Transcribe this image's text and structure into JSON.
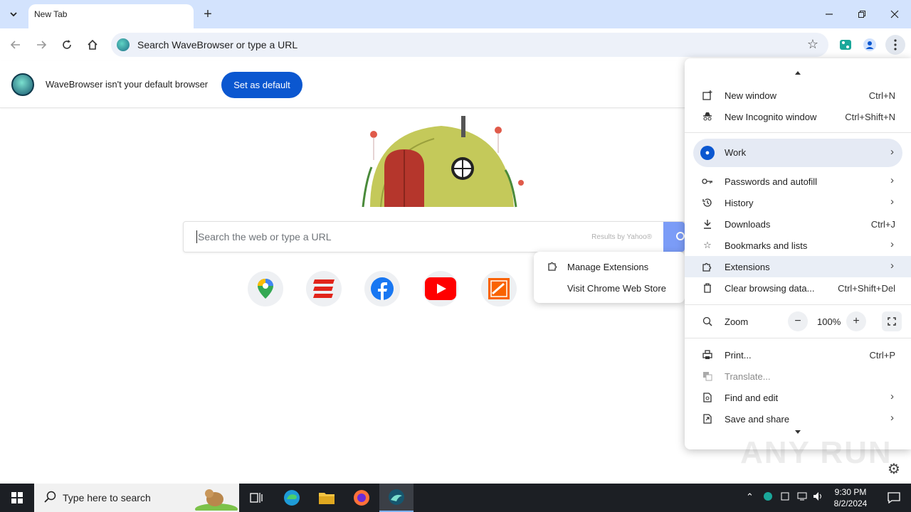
{
  "tabs": [
    {
      "title": "New Tab"
    }
  ],
  "omnibox": {
    "placeholder": "Search WaveBrowser or type a URL"
  },
  "infobar": {
    "message": "WaveBrowser isn't your default browser",
    "button": "Set as default"
  },
  "search": {
    "placeholder": "Search the web or type a URL",
    "provider": "Results by Yahoo®"
  },
  "shortcuts": [
    {
      "name": "Google Maps",
      "color": "#34a853"
    },
    {
      "name": "Eventbrite",
      "color": "#e1251b"
    },
    {
      "name": "Facebook",
      "color": "#1877f2"
    },
    {
      "name": "YouTube",
      "color": "#ff0000"
    },
    {
      "name": "The Home Depot",
      "color": "#f96302"
    }
  ],
  "submenu": {
    "items": [
      {
        "label": "Manage Extensions",
        "icon": "puzzle-icon"
      },
      {
        "label": "Visit Chrome Web Store",
        "icon": ""
      }
    ]
  },
  "menu": {
    "new_window": {
      "label": "New window",
      "shortcut": "Ctrl+N"
    },
    "new_incognito": {
      "label": "New Incognito window",
      "shortcut": "Ctrl+Shift+N"
    },
    "profile": {
      "label": "Work"
    },
    "passwords": {
      "label": "Passwords and autofill"
    },
    "history": {
      "label": "History"
    },
    "downloads": {
      "label": "Downloads",
      "shortcut": "Ctrl+J"
    },
    "bookmarks": {
      "label": "Bookmarks and lists"
    },
    "extensions": {
      "label": "Extensions"
    },
    "clear": {
      "label": "Clear browsing data...",
      "shortcut": "Ctrl+Shift+Del"
    },
    "zoom": {
      "label": "Zoom",
      "value": "100%",
      "minus": "−",
      "plus": "+"
    },
    "print": {
      "label": "Print...",
      "shortcut": "Ctrl+P"
    },
    "translate": {
      "label": "Translate..."
    },
    "find": {
      "label": "Find and edit"
    },
    "save": {
      "label": "Save and share"
    }
  },
  "watermark": "ANY RUN",
  "taskbar": {
    "search_placeholder": "Type here to search",
    "time": "9:30 PM",
    "date": "8/2/2024"
  }
}
